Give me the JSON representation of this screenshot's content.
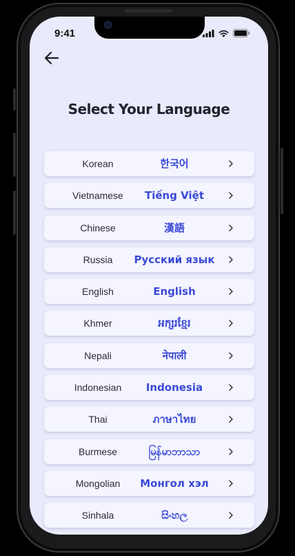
{
  "status_bar": {
    "time": "9:41"
  },
  "page": {
    "title": "Select Your Language"
  },
  "languages": [
    {
      "name": "Korean",
      "native": "한국어"
    },
    {
      "name": "Vietnamese",
      "native": "Tiếng Việt"
    },
    {
      "name": "Chinese",
      "native": "漢語"
    },
    {
      "name": "Russia",
      "native": "Русский язык"
    },
    {
      "name": "English",
      "native": "English"
    },
    {
      "name": "Khmer",
      "native": "អក្សរខ្មែរ"
    },
    {
      "name": "Nepali",
      "native": "नेपाली"
    },
    {
      "name": "Indonesian",
      "native": "Indonesia"
    },
    {
      "name": "Thai",
      "native": "ภาษาไทย"
    },
    {
      "name": "Burmese",
      "native": "မြန်မာဘာသာ"
    },
    {
      "name": "Mongolian",
      "native": "Монгол хэл"
    },
    {
      "name": "Sinhala",
      "native": "සිංහල"
    }
  ],
  "icons": {
    "back": "arrow-left-icon",
    "chevron": "chevron-right-icon",
    "signal": "cellular-signal-icon",
    "wifi": "wifi-icon",
    "battery": "battery-icon"
  },
  "colors": {
    "screen_background": "#e9eafb",
    "item_background": "#f4f5ff",
    "native_text": "#3b49d6",
    "title_text": "#24242e"
  }
}
